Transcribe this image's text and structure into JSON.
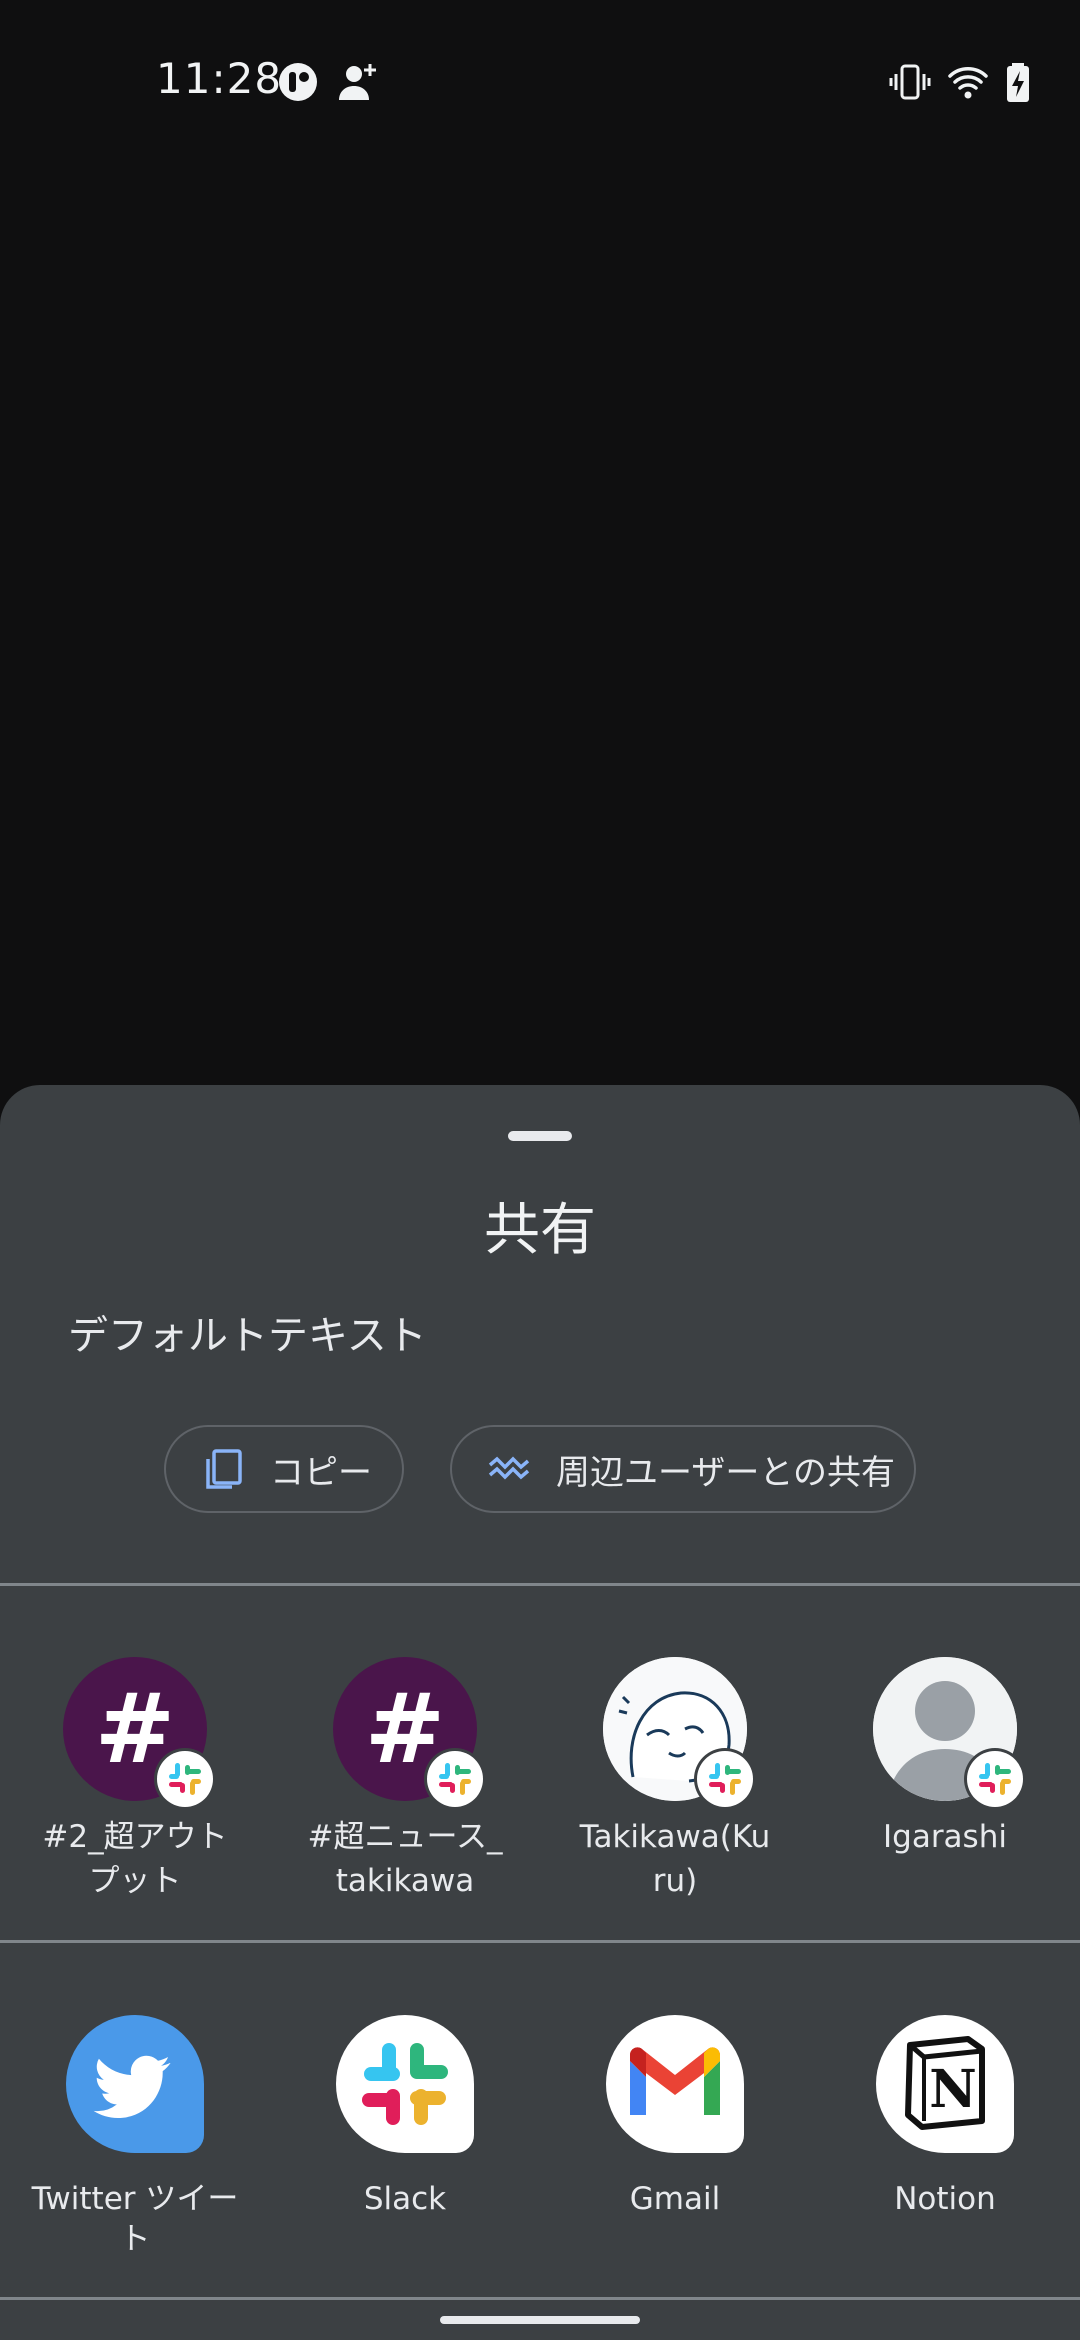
{
  "status_bar": {
    "time": "11:28",
    "icons_left": [
      "app-notification-icon",
      "add-person-icon"
    ],
    "icons_right": [
      "vibrate-icon",
      "wifi-icon",
      "battery-charging-icon"
    ]
  },
  "share_sheet": {
    "title": "共有",
    "preview_text": "デフォルトテキスト",
    "actions": [
      {
        "label": "コピー",
        "icon": "copy-icon"
      },
      {
        "label": "周辺ユーザーとの共有",
        "icon": "nearby-share-icon"
      }
    ],
    "direct_share": [
      {
        "label": "#2_超アウトプット",
        "avatar": "#",
        "badge": "slack-icon"
      },
      {
        "label": "#超ニュース_takikawa",
        "avatar": "#",
        "badge": "slack-icon"
      },
      {
        "label": "Takikawa(Kuru)",
        "avatar": "sketch-avatar",
        "badge": "slack-icon"
      },
      {
        "label": "Igarashi",
        "avatar": "person-placeholder",
        "badge": "slack-icon"
      }
    ],
    "apps": [
      {
        "label": "Twitter ツイート",
        "icon": "twitter-icon",
        "color": "#4a99e9"
      },
      {
        "label": "Slack",
        "icon": "slack-icon",
        "color": "#ffffff"
      },
      {
        "label": "Gmail",
        "icon": "gmail-icon",
        "color": "#ffffff"
      },
      {
        "label": "Notion",
        "icon": "notion-icon",
        "color": "#ffffff"
      }
    ]
  },
  "colors": {
    "sheet_background": "#3c4043",
    "screen_background": "#0f0f10",
    "accent_icon": "#8ab4f8",
    "slack_channel": "#4a154b"
  }
}
